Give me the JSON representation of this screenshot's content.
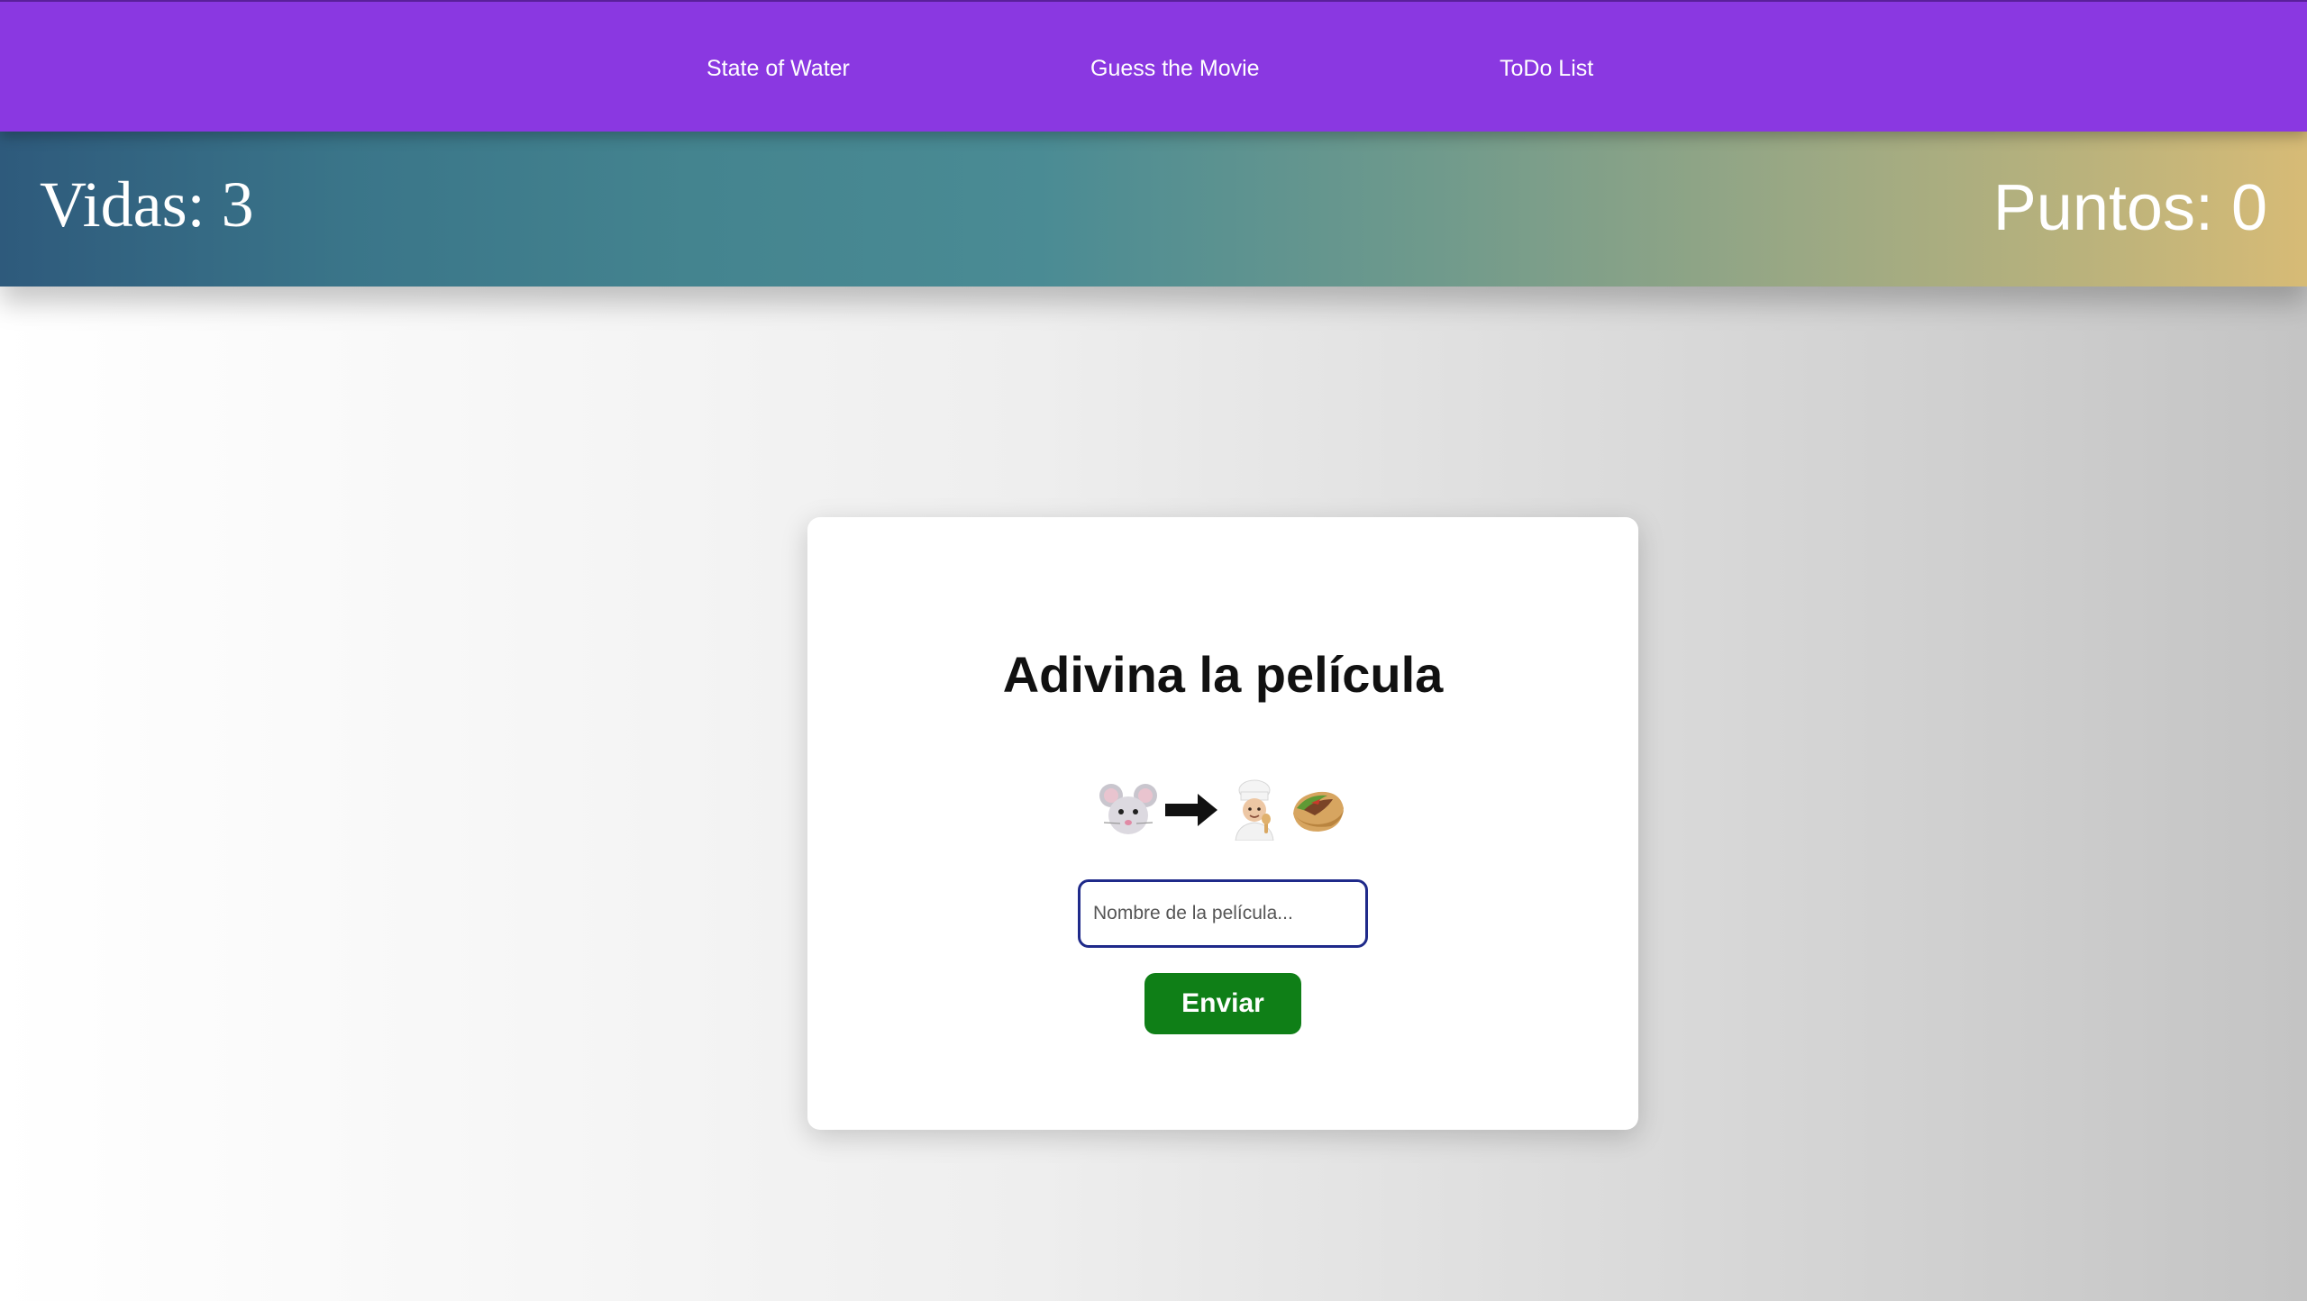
{
  "nav": {
    "links": [
      {
        "label": "State of Water"
      },
      {
        "label": "Guess the Movie"
      },
      {
        "label": "ToDo List"
      }
    ]
  },
  "scoreboard": {
    "lives_text": "Vidas: 3",
    "points_text": "Puntos: 0"
  },
  "game": {
    "title": "Adivina la película",
    "emoji_clue": [
      "mouse-face-icon",
      "right-arrow-icon",
      "cook-icon",
      "stuffed-flatbread-icon"
    ],
    "input": {
      "value": "",
      "placeholder": "Nombre de la película..."
    },
    "submit_label": "Enviar"
  },
  "colors": {
    "nav_background": "#8a38e1",
    "submit_button": "#0f7f17",
    "input_border": "#1f2a8a"
  }
}
